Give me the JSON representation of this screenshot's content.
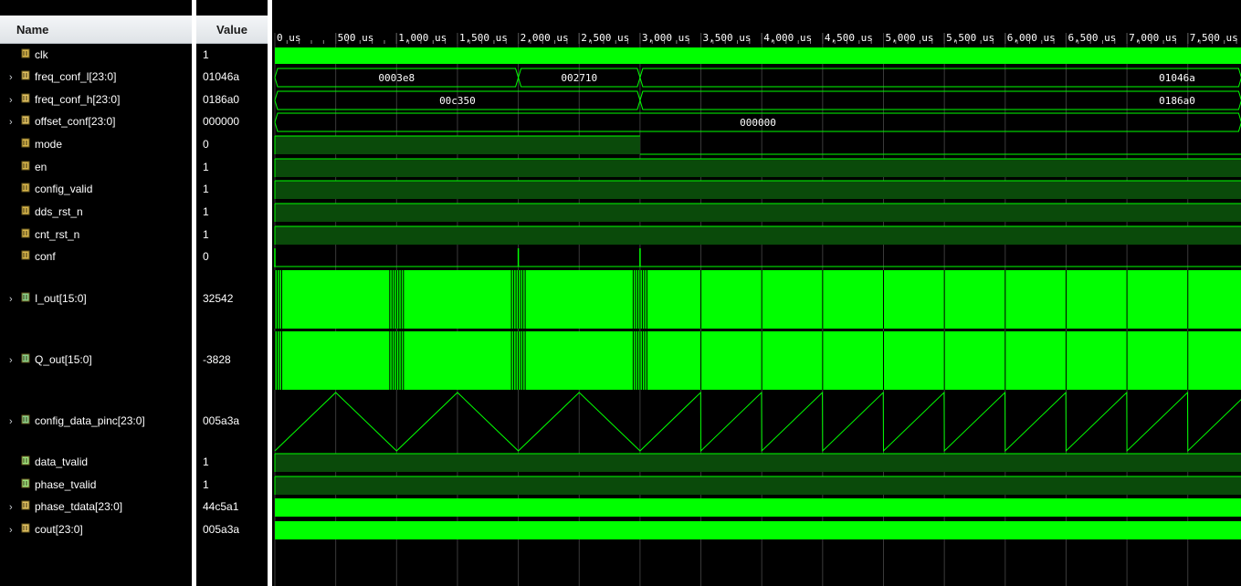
{
  "names_header": "Name",
  "values_header": "Value",
  "timeline": {
    "ticks": [
      {
        "t": 0,
        "label": "0 us"
      },
      {
        "t": 500,
        "label": "500 us"
      },
      {
        "t": 1000,
        "label": "1,000 us"
      },
      {
        "t": 1500,
        "label": "1,500 us"
      },
      {
        "t": 2000,
        "label": "2,000 us"
      },
      {
        "t": 2500,
        "label": "2,500 us"
      },
      {
        "t": 3000,
        "label": "3,000 us"
      },
      {
        "t": 3500,
        "label": "3,500 us"
      },
      {
        "t": 4000,
        "label": "4,000 us"
      },
      {
        "t": 4500,
        "label": "4,500 us"
      },
      {
        "t": 5000,
        "label": "5,000 us"
      },
      {
        "t": 5500,
        "label": "5,500 us"
      },
      {
        "t": 6000,
        "label": "6,000 us"
      },
      {
        "t": 6500,
        "label": "6,500 us"
      },
      {
        "t": 7000,
        "label": "7,000 us"
      },
      {
        "t": 7500,
        "label": "7,500 us"
      }
    ],
    "t_end": 7940
  },
  "colors": {
    "wave": "#00ff00",
    "wave_dim": "#0a4a0a",
    "grid": "#3a3a3a",
    "bg": "#000000"
  },
  "signals": [
    {
      "name": "clk",
      "value": "1",
      "icon": "single-bit-icon",
      "expandable": false,
      "kind": "clock"
    },
    {
      "name": "freq_conf_l[23:0]",
      "value": "01046a",
      "icon": "bus-icon",
      "expandable": true,
      "kind": "bus",
      "segments": [
        {
          "start": 0,
          "end": 2000,
          "label": "0003e8"
        },
        {
          "start": 2000,
          "end": 3000,
          "label": "002710"
        },
        {
          "start": 3000,
          "end": 7940,
          "label": "01046a"
        }
      ]
    },
    {
      "name": "freq_conf_h[23:0]",
      "value": "0186a0",
      "icon": "bus-icon",
      "expandable": true,
      "kind": "bus",
      "segments": [
        {
          "start": 0,
          "end": 3000,
          "label": "00c350"
        },
        {
          "start": 3000,
          "end": 7940,
          "label": "0186a0"
        }
      ]
    },
    {
      "name": "offset_conf[23:0]",
      "value": "000000",
      "icon": "bus-icon",
      "expandable": true,
      "kind": "bus",
      "segments": [
        {
          "start": 0,
          "end": 7940,
          "label": "000000"
        }
      ]
    },
    {
      "name": "mode",
      "value": "0",
      "icon": "single-bit-icon",
      "expandable": false,
      "kind": "bit",
      "levels": [
        {
          "start": 0,
          "end": 3000,
          "v": 1
        },
        {
          "start": 3000,
          "end": 7940,
          "v": 0
        }
      ]
    },
    {
      "name": "en",
      "value": "1",
      "icon": "single-bit-icon",
      "expandable": false,
      "kind": "bit",
      "levels": [
        {
          "start": 0,
          "end": 7940,
          "v": 1
        }
      ]
    },
    {
      "name": "config_valid",
      "value": "1",
      "icon": "single-bit-icon",
      "expandable": false,
      "kind": "bit",
      "levels": [
        {
          "start": 0,
          "end": 7940,
          "v": 1
        }
      ]
    },
    {
      "name": "dds_rst_n",
      "value": "1",
      "icon": "single-bit-icon",
      "expandable": false,
      "kind": "bit",
      "levels": [
        {
          "start": 0,
          "end": 7940,
          "v": 1
        }
      ]
    },
    {
      "name": "cnt_rst_n",
      "value": "1",
      "icon": "single-bit-icon",
      "expandable": false,
      "kind": "bit",
      "levels": [
        {
          "start": 0,
          "end": 7940,
          "v": 1
        }
      ]
    },
    {
      "name": "conf",
      "value": "0",
      "icon": "single-bit-icon",
      "expandable": false,
      "kind": "pulse",
      "pulses": [
        0,
        2000,
        3000
      ]
    },
    {
      "name": "I_out[15:0]",
      "value": "32542",
      "icon": "analog-bus-icon",
      "expandable": true,
      "kind": "analog"
    },
    {
      "name": "Q_out[15:0]",
      "value": "-3828",
      "icon": "analog-bus-icon",
      "expandable": true,
      "kind": "analog"
    },
    {
      "name": "config_data_pinc[23:0]",
      "value": "005a3a",
      "icon": "analog-bus-icon",
      "expandable": true,
      "kind": "sweep",
      "tri_period": 1000,
      "saw_start": 3000,
      "saw_period": 500
    },
    {
      "name": "data_tvalid",
      "value": "1",
      "icon": "output-bit-icon",
      "expandable": false,
      "kind": "bit",
      "levels": [
        {
          "start": 0,
          "end": 7940,
          "v": 1
        }
      ]
    },
    {
      "name": "phase_tvalid",
      "value": "1",
      "icon": "output-bit-icon",
      "expandable": false,
      "kind": "bit",
      "levels": [
        {
          "start": 0,
          "end": 7940,
          "v": 1
        }
      ]
    },
    {
      "name": "phase_tdata[23:0]",
      "value": "44c5a1",
      "icon": "bus-icon",
      "expandable": true,
      "kind": "dense"
    },
    {
      "name": "cout[23:0]",
      "value": "005a3a",
      "icon": "bus-icon",
      "expandable": true,
      "kind": "dense"
    }
  ]
}
